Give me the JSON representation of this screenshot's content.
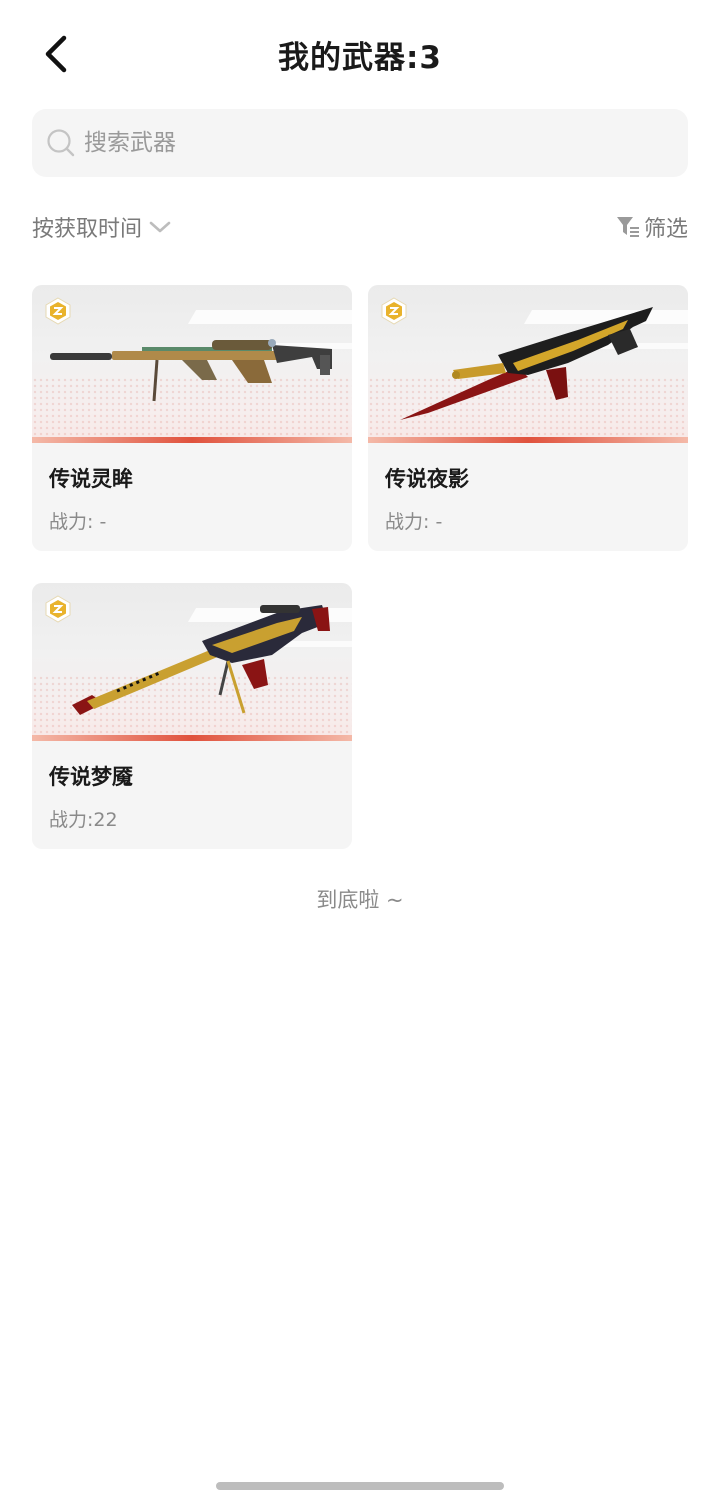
{
  "header": {
    "back_icon": "chevron-left-icon",
    "title": "我的武器:3"
  },
  "search": {
    "icon": "search-icon",
    "placeholder": "搜索武器",
    "value": ""
  },
  "toolbar": {
    "sort_label": "按获取时间",
    "sort_icon": "chevron-down-icon",
    "filter_label": "筛选",
    "filter_icon": "filter-icon"
  },
  "weapons": [
    {
      "name": "传说灵眸",
      "power": "战力: -",
      "badge_icon": "legendary-badge-icon",
      "image": "sniper-rifle-gold-green"
    },
    {
      "name": "传说夜影",
      "power": "战力: -",
      "badge_icon": "legendary-badge-icon",
      "image": "assault-rifle-black-gold-red"
    },
    {
      "name": "传说梦魇",
      "power": "战力:22",
      "badge_icon": "legendary-badge-icon",
      "image": "sniper-rifle-gold-red"
    }
  ],
  "footer": {
    "end_text": "到底啦 ~"
  },
  "colors": {
    "accent_stripe": "#e0523d",
    "card_bg": "#f5f5f5",
    "muted_text": "#8a8a8a",
    "badge_gold": "#e9b32c"
  }
}
